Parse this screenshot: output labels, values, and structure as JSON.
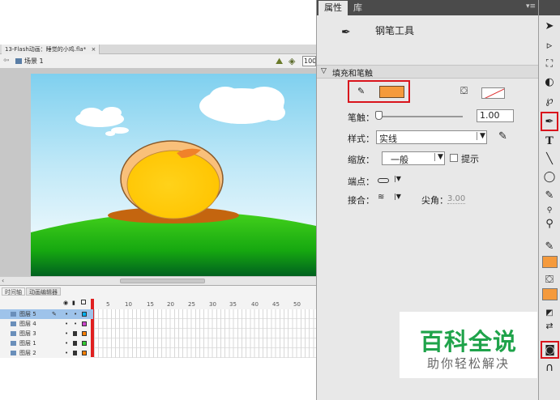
{
  "document": {
    "tab_title": "13-Flash动画：睡觉的小鸡.fla*",
    "tab_close": "×",
    "scene_label": "场景 1",
    "zoom": "100"
  },
  "timeline": {
    "tabs": [
      "时间轴",
      "动画编辑器"
    ],
    "header_icons": [
      "eye-icon",
      "lock-icon",
      "outline-icon"
    ],
    "frame_numbers": [
      "5",
      "10",
      "15",
      "20",
      "25",
      "30",
      "35",
      "40",
      "45",
      "50"
    ],
    "layers": [
      {
        "name": "图层 5",
        "selected": true,
        "locked": false,
        "color": "#00b0f0"
      },
      {
        "name": "图层 4",
        "selected": false,
        "locked": false,
        "color": "#cc44cc"
      },
      {
        "name": "图层 3",
        "selected": false,
        "locked": true,
        "color": "#ff7f00"
      },
      {
        "name": "图层 1",
        "selected": false,
        "locked": true,
        "color": "#33cc33"
      },
      {
        "name": "图层 2",
        "selected": false,
        "locked": true,
        "color": "#ff7f00"
      }
    ]
  },
  "panel": {
    "tabs": [
      "属性",
      "库"
    ],
    "tool_name": "钢笔工具",
    "section_title": "填充和笔触",
    "stroke_color": "#f59a3c",
    "stroke_label": "笔触：",
    "stroke_value": "1.00",
    "style_label": "样式：",
    "style_value": "实线",
    "scale_label": "缩放：",
    "scale_value": "一般",
    "hint_label": "提示",
    "cap_label": "端点：",
    "join_label": "接合：",
    "miter_label": "尖角：",
    "miter_value": "3.00"
  },
  "toolbar": {
    "tools": [
      "selection-tool",
      "subselection-tool",
      "free-transform-tool",
      "3d-rotation-tool",
      "lasso-tool",
      "pen-tool",
      "text-tool",
      "line-tool",
      "oval-tool",
      "pencil-tool",
      "bone-tool",
      "zoom-tool",
      "stroke-color-tool",
      "fill-color-tool",
      "swap-colors-tool",
      "object-drawing-tool",
      "snap-tool"
    ],
    "text_tool_glyph": "T",
    "stroke_swatch": "#f59a3c",
    "fill_swatch": "#f59a3c"
  },
  "watermark": {
    "title": "百科全说",
    "subtitle": "助你轻松解决"
  }
}
